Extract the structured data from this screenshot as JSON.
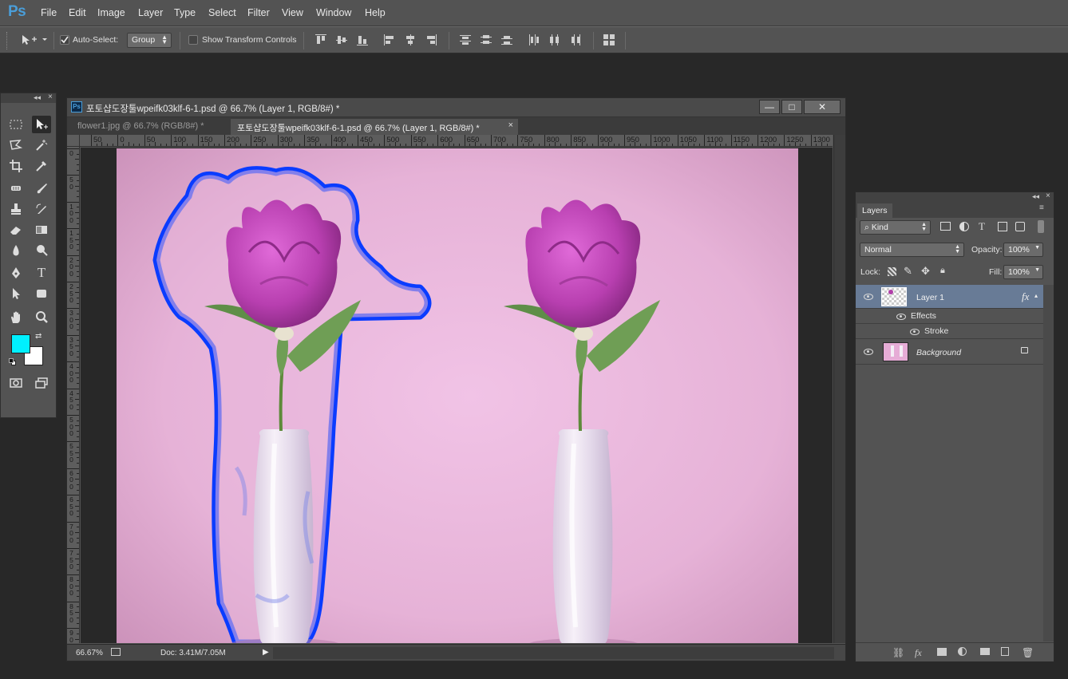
{
  "app": {
    "logo": "Ps"
  },
  "menu": [
    "File",
    "Edit",
    "Image",
    "Layer",
    "Type",
    "Select",
    "Filter",
    "View",
    "Window",
    "Help"
  ],
  "options_bar": {
    "auto_select_label": "Auto-Select:",
    "auto_select_checked": true,
    "auto_select_mode": "Group",
    "show_transform_label": "Show Transform Controls",
    "show_transform_checked": false
  },
  "document": {
    "title": "포토샵도장툴wpeifk03klf-6-1.psd @ 66.7% (Layer 1, RGB/8#) *",
    "tabs": [
      {
        "label": "flower1.jpg @ 66.7% (RGB/8#) *",
        "active": false
      },
      {
        "label": "포토샵도장툴wpeifk03klf-6-1.psd @ 66.7% (Layer 1, RGB/8#) *",
        "active": true,
        "close": "×"
      }
    ],
    "window_buttons": {
      "minimize": "—",
      "maximize": "□",
      "close": "✕"
    },
    "ruler_h": [
      "50",
      "0",
      "50",
      "100",
      "150",
      "200",
      "250",
      "300",
      "350",
      "400",
      "450",
      "500",
      "550",
      "600",
      "650",
      "700",
      "750",
      "800",
      "850",
      "900",
      "950",
      "1000",
      "1050",
      "1100",
      "1150",
      "1200",
      "1250",
      "1300"
    ],
    "ruler_v": [
      "0",
      "50",
      "100",
      "150",
      "200",
      "250",
      "300",
      "350",
      "400",
      "450",
      "500",
      "550",
      "600",
      "650",
      "700",
      "750",
      "800",
      "850",
      "900"
    ],
    "status": {
      "zoom": "66.67%",
      "doc": "Doc: 3.41M/7.05M"
    }
  },
  "colors": {
    "foreground": "#00f0ff",
    "background": "#ffffff",
    "accent_blue": "#0a3cff",
    "canvas_pink": "#e9b4d8"
  },
  "layers_panel": {
    "tab": "Layers",
    "filter_kind": "Kind",
    "blend_mode": "Normal",
    "opacity_label": "Opacity:",
    "opacity": "100%",
    "lock_label": "Lock:",
    "fill_label": "Fill:",
    "fill": "100%",
    "layers": [
      {
        "name": "Layer 1",
        "selected": true,
        "fx": "fx",
        "effects_label": "Effects",
        "effects": [
          "Stroke"
        ]
      },
      {
        "name": "Background",
        "selected": false,
        "locked": true
      }
    ]
  }
}
